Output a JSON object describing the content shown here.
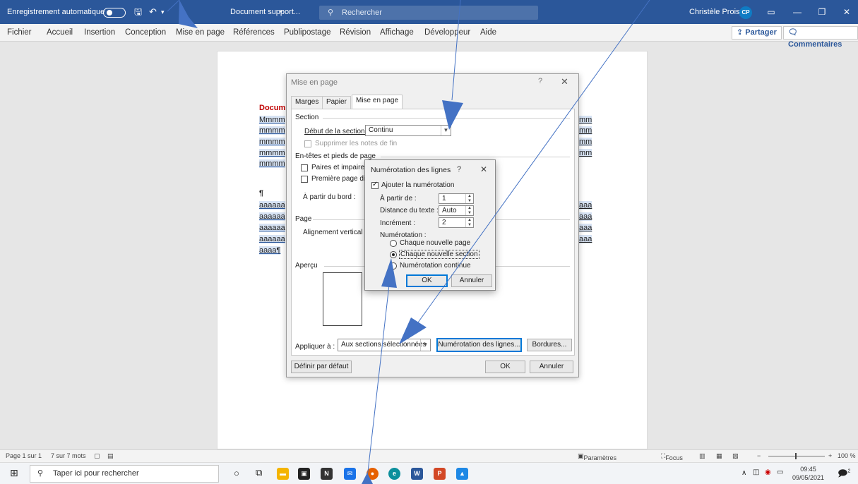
{
  "titlebar": {
    "autosave": "Enregistrement automatique",
    "doc_title": "Document support...",
    "search_placeholder": "Rechercher",
    "user": "Christèle Proisy",
    "initials": "CP"
  },
  "ribbon_tabs": [
    "Fichier",
    "Accueil",
    "Insertion",
    "Conception",
    "Mise en page",
    "Références",
    "Publipostage",
    "Révision",
    "Affichage",
    "Développeur",
    "Aide"
  ],
  "ribbon_right": {
    "share": "Partager",
    "comments": "Commentaires"
  },
  "document": {
    "title": "Docum",
    "lines": [
      "Mmmm",
      "mmmm",
      "mmmm",
      "mmmm",
      "mmmm"
    ],
    "right_lines": [
      "mm",
      "mm",
      "mm",
      "mm"
    ],
    "para_mark": "¶",
    "alines": [
      "aaaaaa",
      "aaaaaa",
      "aaaaaa",
      "aaaaaa",
      "aaaa¶"
    ],
    "right_alines": [
      "aaa",
      "aaa",
      "aaa",
      "aaa"
    ]
  },
  "dialog": {
    "title": "Mise en page",
    "help": "?",
    "tabs": [
      "Marges",
      "Papier",
      "Mise en page"
    ],
    "section_group": "Section",
    "section_start_label": "Début de la section :",
    "section_start_value": "Continu",
    "suppress_endnotes": "Supprimer les notes de fin",
    "headers_group": "En-têtes et pieds de page",
    "odd_even": "Paires et impaires di",
    "first_page": "Première page différ",
    "from_edge": "À partir du bord :",
    "page_group": "Page",
    "vertical_align": "Alignement vertical :",
    "preview_group": "Aperçu",
    "apply_to_label": "Appliquer à :",
    "apply_to_value": "Aux sections sélectionnées",
    "line_numbers_btn": "Numérotation des lignes...",
    "borders_btn": "Bordures...",
    "default_btn": "Définir par défaut",
    "ok": "OK",
    "cancel": "Annuler"
  },
  "subdialog": {
    "title": "Numérotation des lignes",
    "help": "?",
    "add_numbering": "Ajouter la numérotation",
    "start_at_label": "À partir de :",
    "start_at_value": "1",
    "distance_label": "Distance du texte :",
    "distance_value": "Auto",
    "increment_label": "Incrément :",
    "increment_value": "2",
    "numbering_label": "Numérotation :",
    "restart_page": "Chaque nouvelle page",
    "restart_section": "Chaque nouvelle section",
    "continuous": "Numérotation continue",
    "ok": "OK",
    "cancel": "Annuler"
  },
  "statusbar": {
    "page": "Page 1 sur 1",
    "words": "7 sur 7 mots",
    "display_settings": "Paramètres d'affichage",
    "focus": "Focus",
    "zoom": "100 %"
  },
  "taskbar": {
    "search": "Taper ici pour rechercher",
    "time": "09:45",
    "date": "09/05/2021",
    "notif_count": "2"
  }
}
